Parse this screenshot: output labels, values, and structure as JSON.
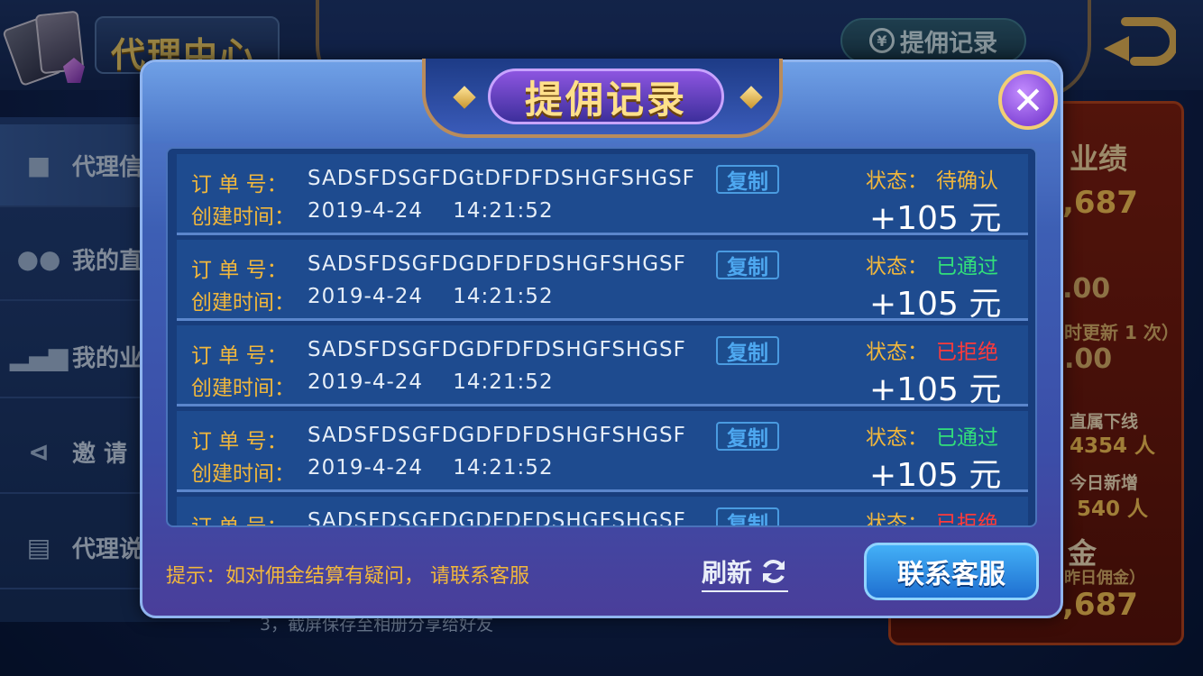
{
  "header": {
    "title": "代理中心",
    "record_button": "提佣记录",
    "record_icon": "¥"
  },
  "sidebar": {
    "items": [
      {
        "label": "代理信",
        "icon": "user-icon"
      },
      {
        "label": "我的直",
        "icon": "users-icon"
      },
      {
        "label": "我的业",
        "icon": "bar-chart-icon"
      },
      {
        "label": "邀  请",
        "icon": "share-icon"
      },
      {
        "label": "代理说",
        "icon": "document-icon"
      }
    ]
  },
  "right_panel": {
    "title": "业绩",
    "value1": ",687",
    "value2": ".00",
    "update_note": "时更新 1 次）",
    "value3": ".00",
    "direct_label": "直属下线",
    "direct_value": "4354 人",
    "today_label": "今日新增",
    "today_value": "540 人",
    "commission_label": "金",
    "commission_sub": "昨日佣金）",
    "commission_value": ",687"
  },
  "background_hint": "3，截屏保存至相册分享给好友",
  "modal": {
    "title": "提佣记录",
    "order_label": "订 单 号：",
    "time_label": "创建时间：",
    "copy_label": "复制",
    "status_label": "状态：",
    "records": [
      {
        "order_no": "SADSFDSGFDGtDFDFDSHGFSHGSF",
        "created": "2019-4-24    14:21:52",
        "status": "待确认",
        "status_color": "#f1b73c",
        "amount": "+105 元"
      },
      {
        "order_no": "SADSFDSGFDGDFDFDSHGFSHGSF",
        "created": "2019-4-24    14:21:52",
        "status": "已通过",
        "status_color": "#32e07a",
        "amount": "+105 元"
      },
      {
        "order_no": "SADSFDSGFDGDFDFDSHGFSHGSF",
        "created": "2019-4-24    14:21:52",
        "status": "已拒绝",
        "status_color": "#ff3a3a",
        "amount": "+105 元"
      },
      {
        "order_no": "SADSFDSGFDGDFDFDSHGFSHGSF",
        "created": "2019-4-24    14:21:52",
        "status": "已通过",
        "status_color": "#32e07a",
        "amount": "+105 元"
      },
      {
        "order_no": "SADSFDSGFDGDFDFDSHGFSHGSF",
        "created": "",
        "status": "已拒绝",
        "status_color": "#ff3a3a",
        "amount": ""
      }
    ],
    "tip": "提示：如对佣金结算有疑问，  请联系客服",
    "refresh_label": "刷新",
    "contact_label": "联系客服"
  }
}
